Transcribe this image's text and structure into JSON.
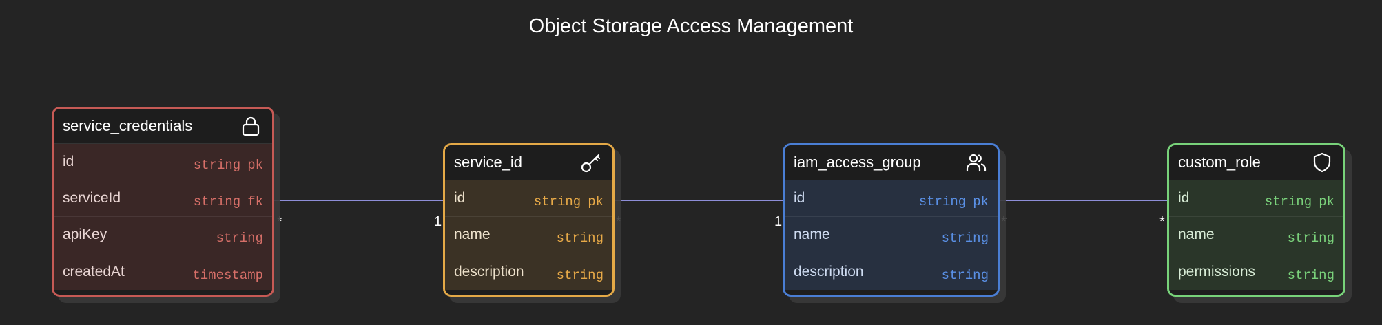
{
  "title": "Object Storage Access Management",
  "entities": [
    {
      "name": "service_credentials",
      "icon": "lock-icon",
      "color": "#c65a55",
      "attributes": [
        {
          "name": "id",
          "type": "string",
          "key": "pk"
        },
        {
          "name": "serviceId",
          "type": "string",
          "key": "fk"
        },
        {
          "name": "apiKey",
          "type": "string",
          "key": ""
        },
        {
          "name": "createdAt",
          "type": "timestamp",
          "key": ""
        }
      ]
    },
    {
      "name": "service_id",
      "icon": "key-icon",
      "color": "#e4a947",
      "attributes": [
        {
          "name": "id",
          "type": "string",
          "key": "pk"
        },
        {
          "name": "name",
          "type": "string",
          "key": ""
        },
        {
          "name": "description",
          "type": "string",
          "key": ""
        }
      ]
    },
    {
      "name": "iam_access_group",
      "icon": "users-icon",
      "color": "#4a7ed4",
      "attributes": [
        {
          "name": "id",
          "type": "string",
          "key": "pk"
        },
        {
          "name": "name",
          "type": "string",
          "key": ""
        },
        {
          "name": "description",
          "type": "string",
          "key": ""
        }
      ]
    },
    {
      "name": "custom_role",
      "icon": "shield-icon",
      "color": "#78d27a",
      "attributes": [
        {
          "name": "id",
          "type": "string",
          "key": "pk"
        },
        {
          "name": "name",
          "type": "string",
          "key": ""
        },
        {
          "name": "permissions",
          "type": "string",
          "key": ""
        }
      ]
    }
  ],
  "relationships": [
    {
      "from": "service_credentials",
      "to": "service_id",
      "from_card": "*",
      "to_card": "1"
    },
    {
      "from": "service_id",
      "to": "iam_access_group",
      "from_card": "*",
      "to_card": "1"
    },
    {
      "from": "iam_access_group",
      "to": "custom_role",
      "from_card": "*",
      "to_card": "*"
    }
  ],
  "colors": {
    "background": "#242424",
    "connector": "#8e8ed8"
  }
}
